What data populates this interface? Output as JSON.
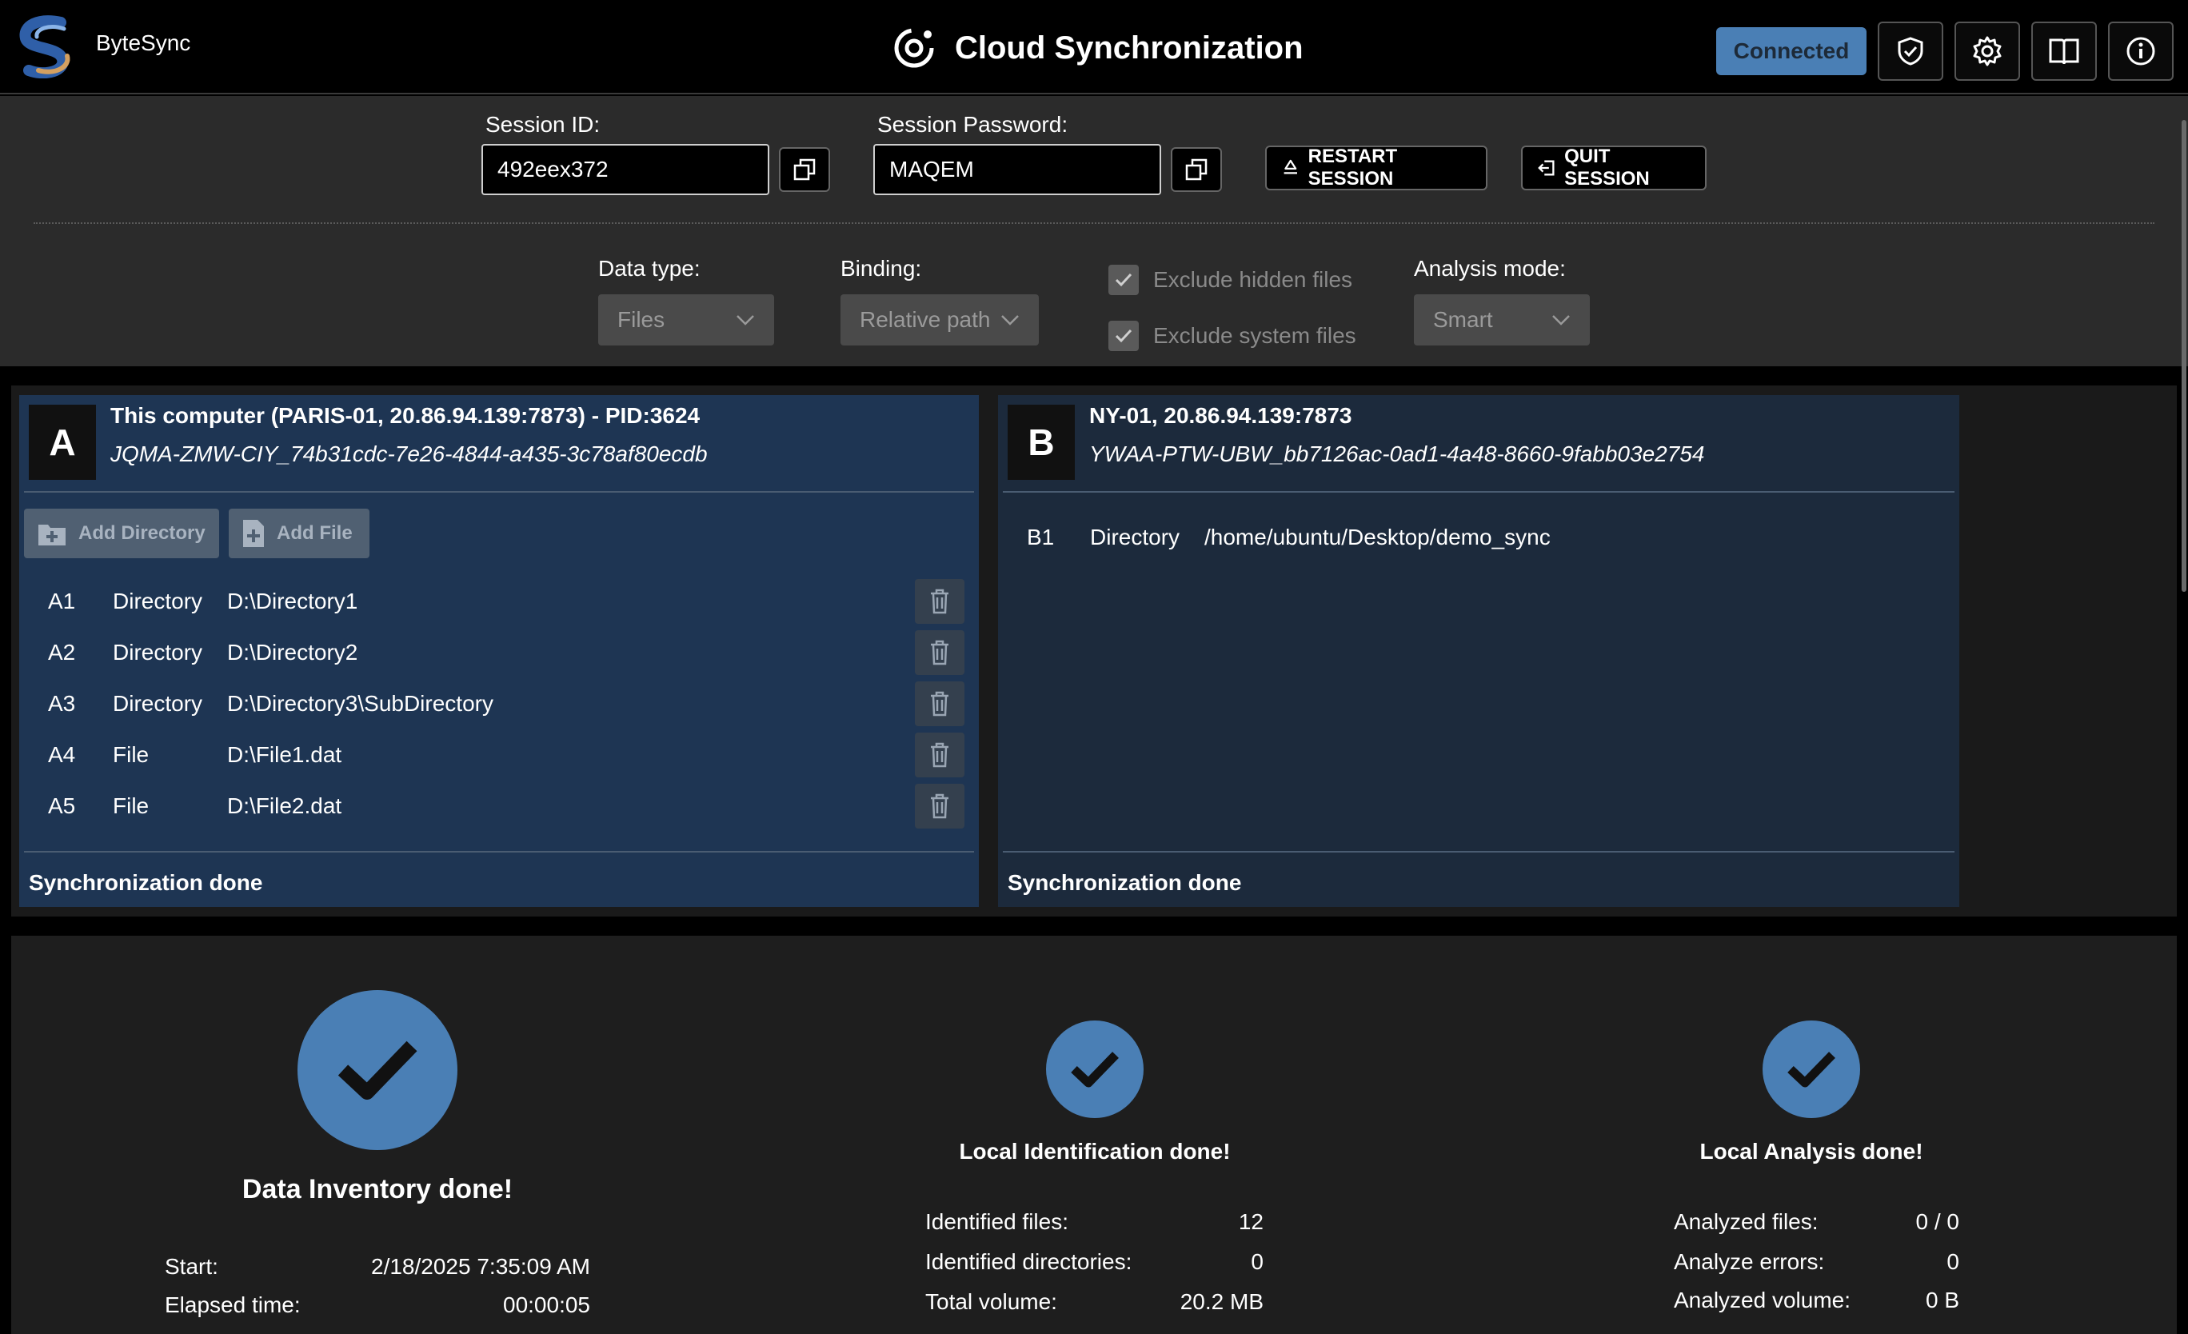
{
  "app": {
    "name": "ByteSync",
    "title": "Cloud Synchronization",
    "status_label": "Connected"
  },
  "header_icons": [
    "shield-check-icon",
    "gear-icon",
    "book-icon",
    "info-icon"
  ],
  "session": {
    "id_label": "Session ID:",
    "id_value": "492eex372",
    "password_label": "Session Password:",
    "password_value": "MAQEM",
    "restart_label": "RESTART SESSION",
    "quit_label": "QUIT SESSION"
  },
  "options": {
    "data_type_label": "Data type:",
    "data_type_value": "Files",
    "binding_label": "Binding:",
    "binding_value": "Relative path",
    "exclude_hidden_label": "Exclude hidden files",
    "exclude_hidden_checked": true,
    "exclude_system_label": "Exclude system files",
    "exclude_system_checked": true,
    "analysis_mode_label": "Analysis mode:",
    "analysis_mode_value": "Smart"
  },
  "panel_a": {
    "letter": "A",
    "title": "This computer (PARIS-01, 20.86.94.139:7873) - PID:3624",
    "id": "JQMA-ZMW-CIY_74b31cdc-7e26-4844-a435-3c78af80ecdb",
    "add_directory_label": "Add Directory",
    "add_file_label": "Add File",
    "items": [
      {
        "code": "A1",
        "type": "Directory",
        "path": "D:\\Directory1"
      },
      {
        "code": "A2",
        "type": "Directory",
        "path": "D:\\Directory2"
      },
      {
        "code": "A3",
        "type": "Directory",
        "path": "D:\\Directory3\\SubDirectory"
      },
      {
        "code": "A4",
        "type": "File",
        "path": "D:\\File1.dat"
      },
      {
        "code": "A5",
        "type": "File",
        "path": "D:\\File2.dat"
      }
    ],
    "status": "Synchronization done"
  },
  "panel_b": {
    "letter": "B",
    "title": "NY-01, 20.86.94.139:7873",
    "id": "YWAA-PTW-UBW_bb7126ac-0ad1-4a48-8660-9fabb03e2754",
    "items": [
      {
        "code": "B1",
        "type": "Directory",
        "path": "/home/ubuntu/Desktop/demo_sync"
      }
    ],
    "status": "Synchronization done"
  },
  "inventory": {
    "title": "Data Inventory done!",
    "start_label": "Start:",
    "start_value": "2/18/2025 7:35:09 AM",
    "elapsed_label": "Elapsed time:",
    "elapsed_value": "00:00:05"
  },
  "identification": {
    "title": "Local Identification done!",
    "files_label": "Identified files:",
    "files_value": "12",
    "dirs_label": "Identified directories:",
    "dirs_value": "0",
    "volume_label": "Total volume:",
    "volume_value": "20.2 MB"
  },
  "analysis": {
    "title": "Local Analysis done!",
    "files_label": "Analyzed files:",
    "files_value": "0 / 0",
    "errors_label": "Analyze errors:",
    "errors_value": "0",
    "volume_label": "Analyzed volume:",
    "volume_value": "0 B"
  }
}
